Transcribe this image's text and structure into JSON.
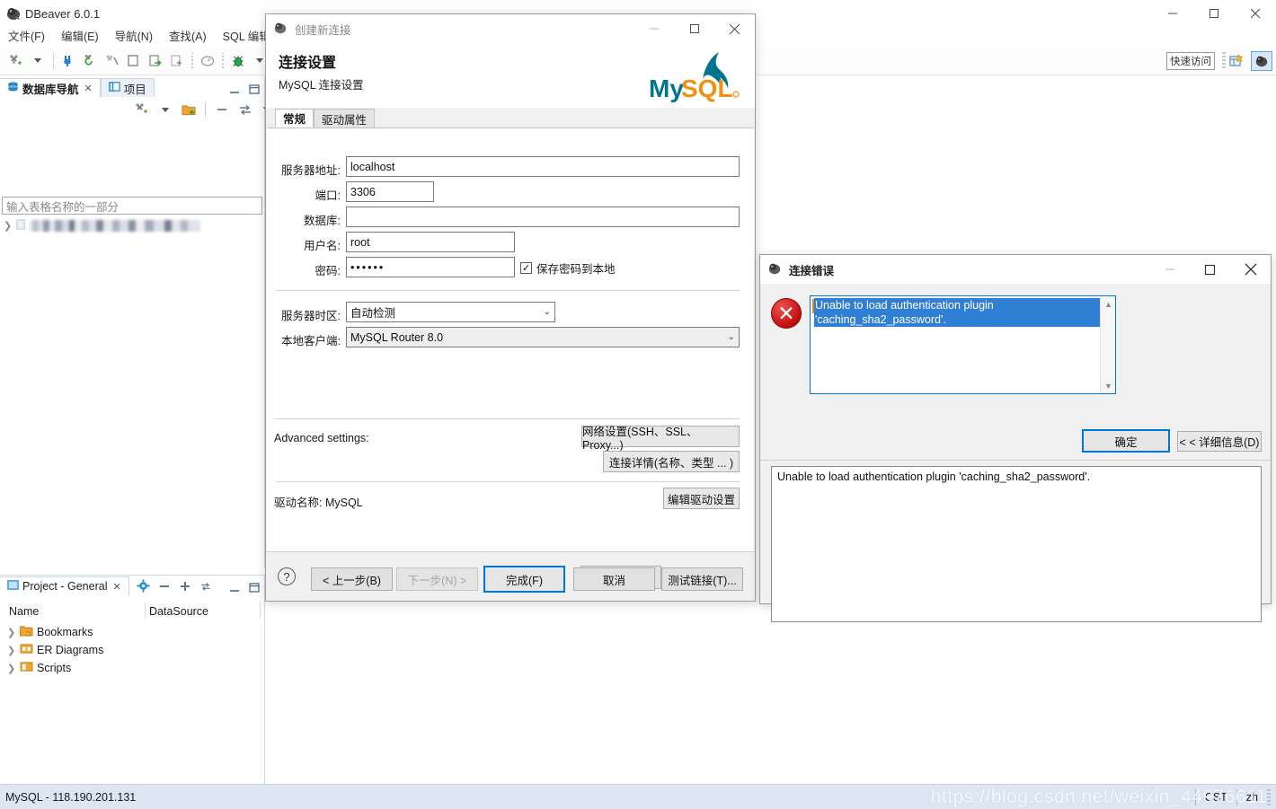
{
  "app": {
    "title": "DBeaver 6.0.1",
    "logo_icon": "dbeaver-beaver-icon",
    "window_controls": [
      "minimize",
      "maximize",
      "close"
    ]
  },
  "menubar": {
    "items": [
      {
        "label": "文件(F)",
        "name": "menu-file"
      },
      {
        "label": "编辑(E)",
        "name": "menu-edit"
      },
      {
        "label": "导航(N)",
        "name": "menu-navigate"
      },
      {
        "label": "查找(A)",
        "name": "menu-search"
      },
      {
        "label": "SQL 编辑器",
        "name": "menu-sql-editor"
      }
    ]
  },
  "toolbar": {
    "quick_access_label": "快速访问",
    "icons": [
      "new-connection-icon",
      "dropdown-caret-icon",
      "connect-icon",
      "refresh-connection-icon",
      "disconnect-icon",
      "sql-editor-icon",
      "open-sql-script-icon",
      "new-sql-script-icon",
      "dashboard-icon",
      "debug-icon",
      "debug-caret-icon",
      "paint-icon"
    ],
    "perspective_icons": [
      "new-perspective-icon",
      "dbeaver-perspective-icon"
    ]
  },
  "navigator_panel": {
    "tabs": [
      {
        "label": "数据库导航",
        "name": "tab-database-navigator",
        "icon": "database-icon",
        "active": true,
        "closable": true
      },
      {
        "label": "项目",
        "name": "tab-projects",
        "icon": "project-icon",
        "active": false,
        "closable": false
      }
    ],
    "toolbar_icons": [
      "new-connection-icon",
      "dropdown-caret-icon",
      "new-folder-icon",
      "collapse-all-icon",
      "link-editor-icon",
      "view-menu-icon"
    ],
    "panel_controls": [
      "minimize",
      "maximize"
    ],
    "filter_placeholder": "输入表格名称的一部分",
    "tree_items": [
      {
        "label": "",
        "name": "tree-item-connection",
        "redacted": true,
        "expandable": true
      }
    ]
  },
  "project_panel": {
    "tab": {
      "label": "Project - General",
      "name": "tab-project-general",
      "icon": "project-icon",
      "closable": true
    },
    "toolbar_icons": [
      "gear-icon",
      "collapse-all-icon",
      "expand-all-icon",
      "link-editor-icon"
    ],
    "panel_controls": [
      "minimize",
      "maximize"
    ],
    "columns": [
      "Name",
      "DataSource"
    ],
    "rows": [
      {
        "label": "Bookmarks",
        "name": "tree-item-bookmarks",
        "icon": "bookmarks-folder-icon",
        "datasource": ""
      },
      {
        "label": "ER Diagrams",
        "name": "tree-item-er-diagrams",
        "icon": "er-diagram-icon",
        "datasource": ""
      },
      {
        "label": "Scripts",
        "name": "tree-item-scripts",
        "icon": "scripts-folder-icon",
        "datasource": ""
      }
    ]
  },
  "statusbar": {
    "connection": "MySQL - 118.190.201.131",
    "timezone": "CST",
    "language": "zh",
    "watermark": "https://blog.csdn.net/weixin_44976611"
  },
  "connection_dialog": {
    "window_title": "创建新连接",
    "window_icon": "dbeaver-beaver-icon",
    "heading": "连接设置",
    "subheading": "MySQL 连接设置",
    "brand_logo": "mysql-logo",
    "brand_text_primary": "My",
    "brand_text_secondary": "SQL",
    "brand_color_primary": "#00758F",
    "brand_color_secondary": "#F29111",
    "tabs": [
      {
        "label": "常规",
        "name": "tab-general",
        "active": true
      },
      {
        "label": "驱动属性",
        "name": "tab-driver-properties",
        "active": false
      }
    ],
    "fields": [
      {
        "label": "服务器地址:",
        "value": "localhost",
        "name": "server-host-input"
      },
      {
        "label": "端口:",
        "value": "3306",
        "name": "port-input"
      },
      {
        "label": "数据库:",
        "value": "",
        "name": "database-input"
      },
      {
        "label": "用户名:",
        "value": "root",
        "name": "username-input"
      },
      {
        "label": "密码:",
        "value": "••••••",
        "name": "password-input"
      }
    ],
    "save_password": {
      "label": "保存密码到本地",
      "checked": true,
      "name": "save-password-checkbox",
      "mark": "✓"
    },
    "server_timezone": {
      "label": "服务器时区:",
      "value": "自动检测",
      "name": "server-timezone-select"
    },
    "local_client": {
      "label": "本地客户端:",
      "value": "MySQL Router 8.0",
      "name": "local-client-select"
    },
    "advanced_label": "Advanced settings:",
    "advanced_buttons": [
      {
        "label": "网络设置(SSH、SSL、Proxy...)",
        "name": "network-settings-button"
      },
      {
        "label": "连接详情(名称、类型 ... )",
        "name": "connection-details-button"
      }
    ],
    "driver_label": "驱动名称:  MySQL",
    "edit_driver_button": {
      "label": "编辑驱动设置",
      "name": "edit-driver-settings-button"
    },
    "help_icon": "help-question-icon",
    "footer_buttons": [
      {
        "label": "< 上一步(B)",
        "name": "back-button",
        "state": "enabled"
      },
      {
        "label": "下一步(N) >",
        "name": "next-button",
        "state": "disabled"
      },
      {
        "label": "完成(F)",
        "name": "finish-button",
        "state": "default"
      },
      {
        "label": "取消",
        "name": "cancel-button",
        "state": "enabled"
      },
      {
        "label": "测试链接(T)...",
        "name": "test-connection-button",
        "state": "enabled"
      }
    ]
  },
  "error_dialog": {
    "window_title": "连接错误",
    "window_icon": "dbeaver-beaver-icon",
    "error_icon": "error-cross-icon",
    "message": "Unable to load authentication plugin 'caching_sha2_password'.",
    "message_selected": true,
    "buttons": [
      {
        "label": "确定",
        "name": "ok-button",
        "state": "default"
      },
      {
        "label": "< < 详细信息(D)",
        "name": "details-toggle-button",
        "state": "enabled"
      }
    ],
    "details_text": "Unable to load authentication plugin 'caching_sha2_password'.",
    "scrollbar": {
      "up": "▲",
      "down": "▼"
    }
  },
  "colors": {
    "accent": "#0078d7",
    "selection": "#2f7fd4",
    "status_bg": "#dde6f2",
    "error_red": "#c30d0d"
  }
}
